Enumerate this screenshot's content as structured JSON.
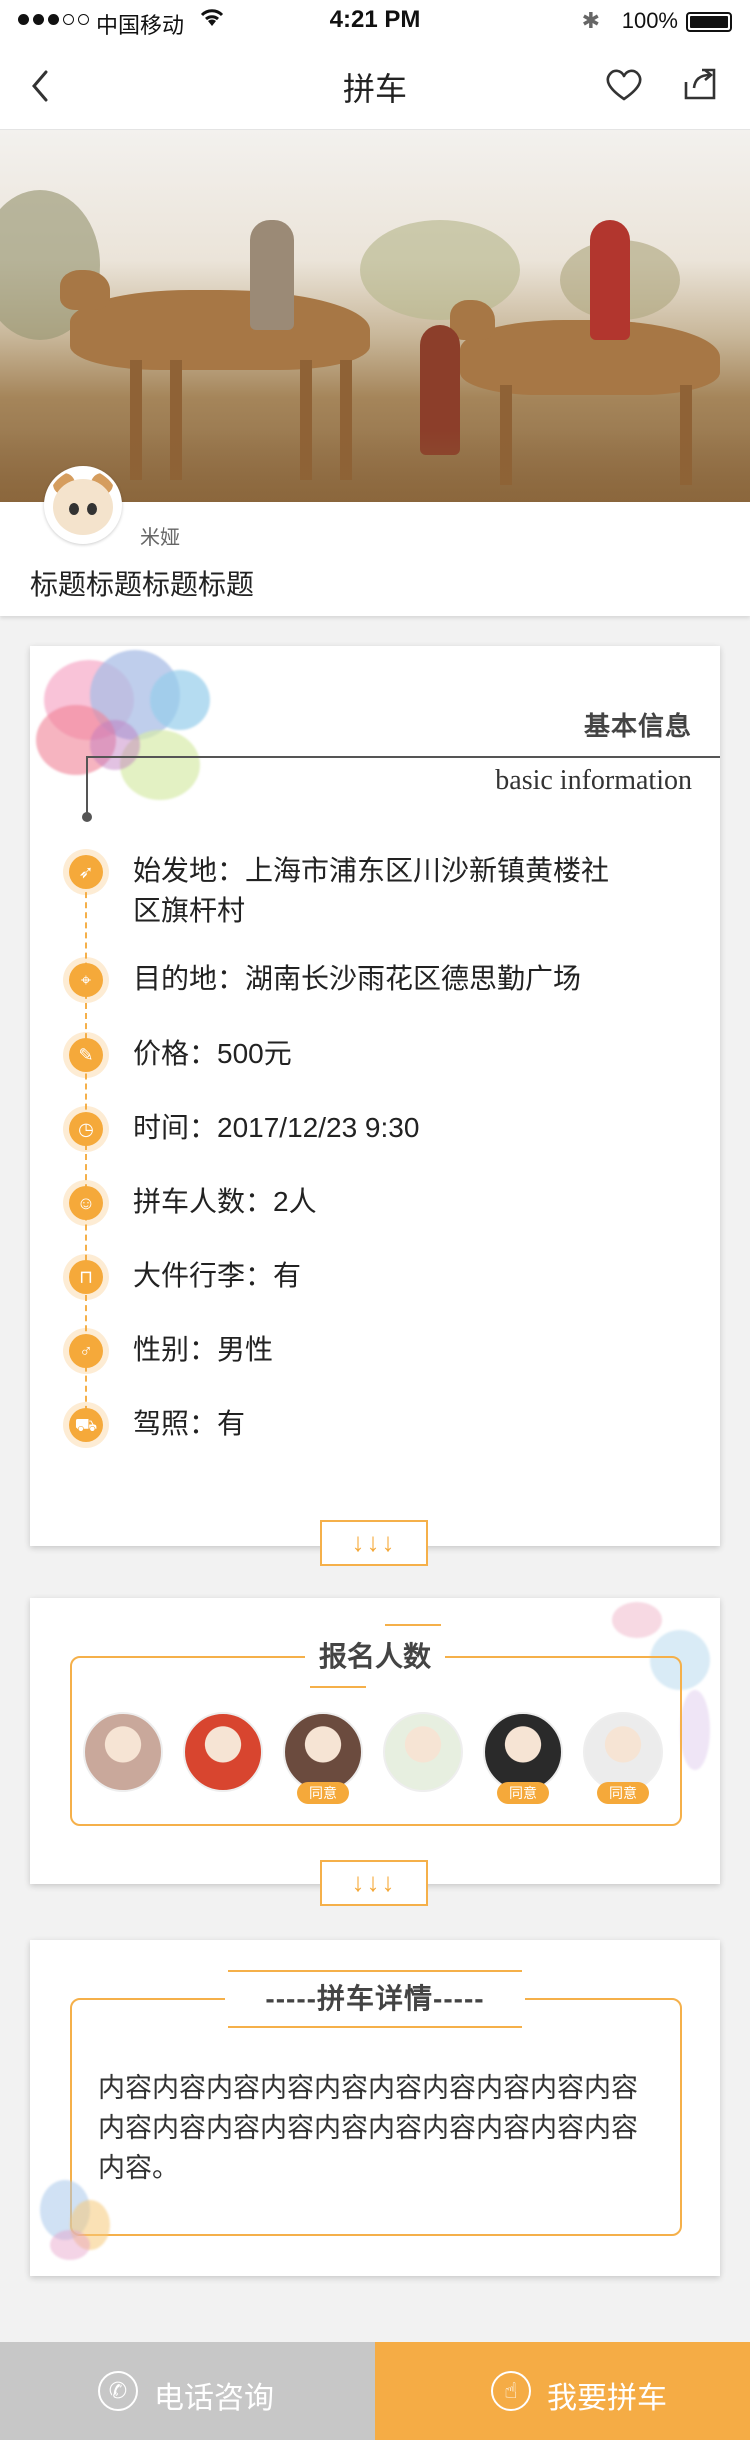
{
  "status_bar": {
    "carrier": "中国移动",
    "time": "4:21 PM",
    "battery": "100%"
  },
  "nav": {
    "title": "拼车"
  },
  "post": {
    "username": "米娅",
    "title": "标题标题标题标题"
  },
  "basic_info": {
    "title_cn": "基本信息",
    "title_en": "basic information",
    "items": [
      {
        "icon": "rocket-icon",
        "label": "始发地：上海市浦东区川沙新镇黄楼社",
        "label2": "区旗杆村"
      },
      {
        "icon": "location-pin-icon",
        "label": "目的地：湖南长沙雨花区德思勤广场"
      },
      {
        "icon": "price-tag-icon",
        "label": "价格：500元"
      },
      {
        "icon": "clock-icon",
        "label": "时间：2017/12/23  9:30"
      },
      {
        "icon": "person-icon",
        "label": "拼车人数：2人"
      },
      {
        "icon": "luggage-icon",
        "label": "大件行李：有"
      },
      {
        "icon": "gender-icon",
        "label": "性别：男性"
      },
      {
        "icon": "car-icon",
        "label": "驾照：有"
      }
    ],
    "expand_label": "↓↓↓"
  },
  "applicants": {
    "title": "报名人数",
    "expand_label": "↓↓↓",
    "badge_label": "同意",
    "members": [
      {
        "avatar_color": "#c9a89b",
        "approved": false
      },
      {
        "avatar_color": "#d8452f",
        "approved": false
      },
      {
        "avatar_color": "#6b4b3e",
        "approved": true
      },
      {
        "avatar_color": "#e7efe0",
        "approved": false
      },
      {
        "avatar_color": "#2a2a2a",
        "approved": true
      },
      {
        "avatar_color": "#ececec",
        "approved": true
      }
    ]
  },
  "details": {
    "title": "-----拼车详情-----",
    "content": "内容内容内容内容内容内容内容内容内容内容内容内容内容内容内容内容内容内容内容内容内容。"
  },
  "bottom_bar": {
    "consult_label": "电话咨询",
    "join_label": "我要拼车"
  },
  "colors": {
    "accent": "#f5a93a",
    "consult_bg": "#c7c7c7",
    "join_bg": "#f5ac45"
  }
}
